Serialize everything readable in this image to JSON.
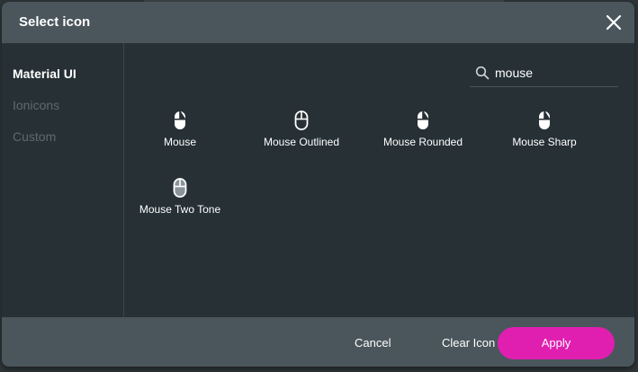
{
  "dialog": {
    "title": "Select icon",
    "close_icon": "close-icon"
  },
  "sidebar": {
    "items": [
      {
        "label": "Material UI",
        "active": true
      },
      {
        "label": "Ionicons",
        "active": false
      },
      {
        "label": "Custom",
        "active": false
      }
    ]
  },
  "search": {
    "value": "mouse",
    "icon": "search-icon"
  },
  "results": [
    {
      "label": "Mouse",
      "icon": "mouse-icon"
    },
    {
      "label": "Mouse Outlined",
      "icon": "mouse-outlined-icon"
    },
    {
      "label": "Mouse Rounded",
      "icon": "mouse-rounded-icon"
    },
    {
      "label": "Mouse Sharp",
      "icon": "mouse-sharp-icon"
    },
    {
      "label": "Mouse Two Tone",
      "icon": "mouse-two-tone-icon"
    }
  ],
  "footer": {
    "cancel_label": "Cancel",
    "clear_label": "Clear Icon",
    "apply_label": "Apply"
  },
  "colors": {
    "accent": "#e01fb0",
    "header_bg": "#4a565c",
    "body_bg": "#263035"
  }
}
